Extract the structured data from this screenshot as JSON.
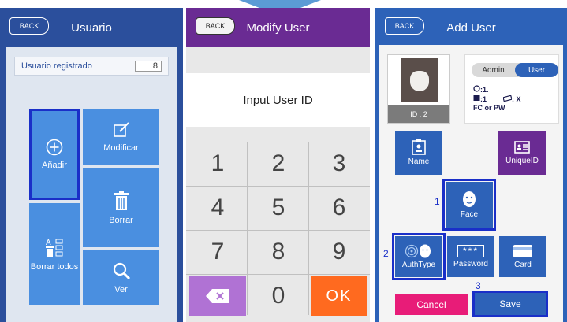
{
  "panel1": {
    "back_label": "BACK",
    "title": "Usuario",
    "registered_label": "Usuario registrado",
    "registered_count": "8",
    "tiles": {
      "add": "Añadir",
      "modify": "Modificar",
      "delete": "Borrar",
      "delete_all": "Borrar todos",
      "view": "Ver"
    }
  },
  "panel2": {
    "back_label": "BACK",
    "title": "Modify User",
    "input_prompt": "Input User ID",
    "keys": [
      "1",
      "2",
      "3",
      "4",
      "5",
      "6",
      "7",
      "8",
      "9",
      "0"
    ],
    "ok_label": "OK"
  },
  "panel3": {
    "back_label": "BACK",
    "title": "Add User",
    "photo_id": "ID : 2",
    "role_admin": "Admin",
    "role_user": "User",
    "face_count": ":1.",
    "card_count": ":1",
    "password_mark": ": X",
    "auth_mode": "FC or PW",
    "buttons": {
      "name": "Name",
      "unique_id": "UniqueID",
      "face": "Face",
      "auth_type": "AuthType",
      "password": "Password",
      "password_mask": "***",
      "card": "Card",
      "cancel": "Cancel",
      "save": "Save"
    },
    "step_numbers": [
      "1",
      "2",
      "3"
    ]
  },
  "colors": {
    "blue_header": "#2b4f9c",
    "purple": "#6a2b93",
    "tile_blue": "#4a8fe0",
    "ok_orange": "#ff6a1f",
    "cancel_pink": "#e81c78",
    "highlight": "#1a2fc8"
  }
}
